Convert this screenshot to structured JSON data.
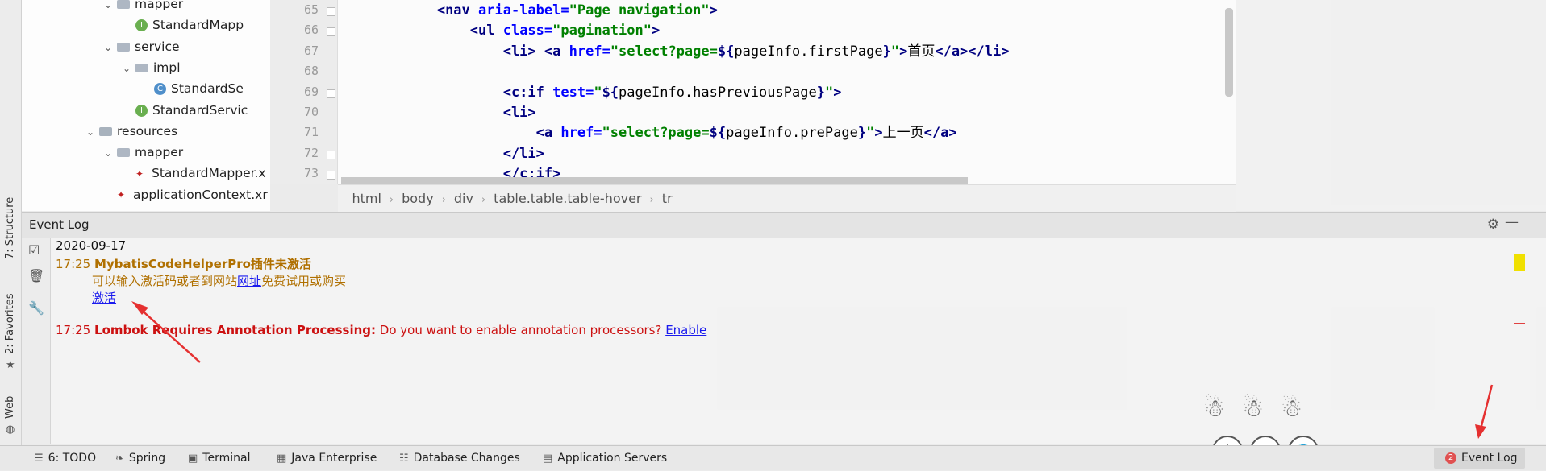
{
  "project_tree": [
    {
      "label": "mapper",
      "arrow": "expanded",
      "icon": "folder",
      "indent": 1
    },
    {
      "label": "StandardMapp",
      "arrow": "none",
      "icon": "interface",
      "indent": 2
    },
    {
      "label": "service",
      "arrow": "expanded",
      "icon": "folder",
      "indent": 1
    },
    {
      "label": "impl",
      "arrow": "expanded",
      "icon": "folder",
      "indent": 2
    },
    {
      "label": "StandardSe",
      "arrow": "none",
      "icon": "class",
      "indent": 3
    },
    {
      "label": "StandardServic",
      "arrow": "none",
      "icon": "interface",
      "indent": 2
    },
    {
      "label": "resources",
      "arrow": "expanded",
      "icon": "resources-folder",
      "indent": 0
    },
    {
      "label": "mapper",
      "arrow": "expanded",
      "icon": "folder",
      "indent": 1
    },
    {
      "label": "StandardMapper.x",
      "arrow": "none",
      "icon": "xml",
      "indent": 2
    },
    {
      "label": "applicationContext.xr",
      "arrow": "none",
      "icon": "xml",
      "indent": 1
    }
  ],
  "editor": {
    "line_numbers": [
      "65",
      "66",
      "67",
      "68",
      "69",
      "70",
      "71",
      "72",
      "73"
    ],
    "lines": [
      {
        "indent": "            ",
        "segs": [
          {
            "c": "tg",
            "t": "<nav "
          },
          {
            "c": "at",
            "t": "aria-label="
          },
          {
            "c": "st",
            "t": "\"Page navigation\""
          },
          {
            "c": "tg",
            "t": ">"
          }
        ]
      },
      {
        "indent": "                ",
        "segs": [
          {
            "c": "tg",
            "t": "<ul "
          },
          {
            "c": "at",
            "t": "class="
          },
          {
            "c": "st",
            "t": "\"pagination\""
          },
          {
            "c": "tg",
            "t": ">"
          }
        ]
      },
      {
        "indent": "                    ",
        "segs": [
          {
            "c": "tg",
            "t": "<li>"
          },
          {
            "c": "tx",
            "t": " "
          },
          {
            "c": "tg",
            "t": "<a "
          },
          {
            "c": "at",
            "t": "href="
          },
          {
            "c": "st",
            "t": "\"select?page="
          },
          {
            "c": "el",
            "t": "${"
          },
          {
            "c": "tx",
            "t": "pageInfo.firstPage"
          },
          {
            "c": "el",
            "t": "}"
          },
          {
            "c": "st",
            "t": "\""
          },
          {
            "c": "tg",
            "t": ">"
          },
          {
            "c": "tx",
            "t": "首页"
          },
          {
            "c": "tg",
            "t": "</a></li>"
          }
        ]
      },
      {
        "indent": "",
        "segs": []
      },
      {
        "indent": "                    ",
        "segs": [
          {
            "c": "tg",
            "t": "<c:if "
          },
          {
            "c": "at",
            "t": "test="
          },
          {
            "c": "st",
            "t": "\""
          },
          {
            "c": "el",
            "t": "${"
          },
          {
            "c": "tx",
            "t": "pageInfo.hasPreviousPage"
          },
          {
            "c": "el",
            "t": "}"
          },
          {
            "c": "st",
            "t": "\""
          },
          {
            "c": "tg",
            "t": ">"
          }
        ]
      },
      {
        "indent": "                    ",
        "segs": [
          {
            "c": "tg",
            "t": "<li>"
          }
        ]
      },
      {
        "indent": "                        ",
        "segs": [
          {
            "c": "tg",
            "t": "<a "
          },
          {
            "c": "at",
            "t": "href="
          },
          {
            "c": "st",
            "t": "\"select?page="
          },
          {
            "c": "el",
            "t": "${"
          },
          {
            "c": "tx",
            "t": "pageInfo.prePage"
          },
          {
            "c": "el",
            "t": "}"
          },
          {
            "c": "st",
            "t": "\""
          },
          {
            "c": "tg",
            "t": ">"
          },
          {
            "c": "tx",
            "t": "上一页"
          },
          {
            "c": "tg",
            "t": "</a>"
          }
        ]
      },
      {
        "indent": "                    ",
        "segs": [
          {
            "c": "tg",
            "t": "</li>"
          }
        ]
      },
      {
        "indent": "                    ",
        "segs": [
          {
            "c": "tg",
            "t": "</c:if>"
          }
        ]
      }
    ],
    "breadcrumbs": [
      "html",
      "body",
      "div",
      "table.table.table-hover",
      "tr"
    ]
  },
  "left_strip": {
    "structure": "7: Structure",
    "favorites": "2: Favorites",
    "web": "Web"
  },
  "event_log": {
    "title": "Event Log",
    "date": "2020-09-17",
    "entry1": {
      "time": "17:25",
      "title": "MybatisCodeHelperPro插件未激活",
      "msg_before": "可以输入激活码或者到网站",
      "msg_link": "网址",
      "msg_after": "免费试用或购买",
      "action": "激活"
    },
    "entry2": {
      "time": "17:25",
      "title": "Lombok Requires Annotation Processing:",
      "msg": "Do you want to enable annotation processors?",
      "action": "Enable"
    }
  },
  "status_bar": {
    "todo": "6: TODO",
    "spring": "Spring",
    "terminal": "Terminal",
    "java_enterprise": "Java Enterprise",
    "db_changes": "Database Changes",
    "app_servers": "Application Servers",
    "event_log_count": "2",
    "event_log": "Event Log"
  },
  "ime_bar": {
    "lang": "中",
    "punct": "°,",
    "skin": "👕"
  },
  "colors": {
    "warning": "#b07000",
    "error": "#cc1111",
    "link": "#1a1aee",
    "annotation_arrow": "#e53030"
  }
}
